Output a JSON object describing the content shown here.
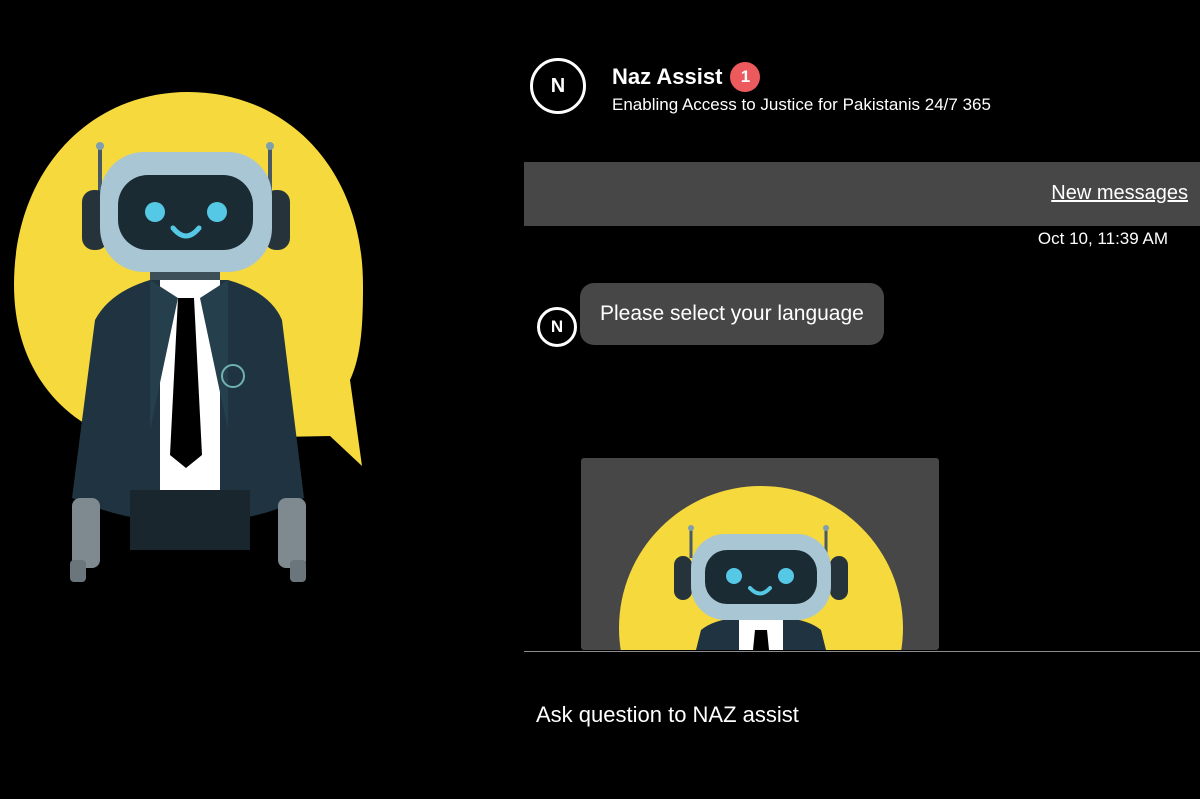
{
  "header": {
    "avatar_initial": "N",
    "title": "Naz Assist",
    "badge_count": "1",
    "subtitle": "Enabling Access to Justice for Pakistanis 24/7 365"
  },
  "chat": {
    "new_messages_label": "New messages",
    "timestamp": "Oct 10, 11:39 AM",
    "messages": [
      {
        "avatar_initial": "N",
        "text": "Please select your language"
      }
    ]
  },
  "composer": {
    "placeholder": "Ask question to NAZ assist"
  },
  "colors": {
    "background": "#000000",
    "accent_yellow": "#f5d93d",
    "bubble": "#474747",
    "badge": "#ec5a5e",
    "robot_face": "#a9c6d4",
    "robot_eye": "#55c8e5",
    "suit": "#1f3440"
  },
  "icons": {
    "hero": "robot-mascot-illustration",
    "card": "robot-mascot-thumbnail"
  }
}
